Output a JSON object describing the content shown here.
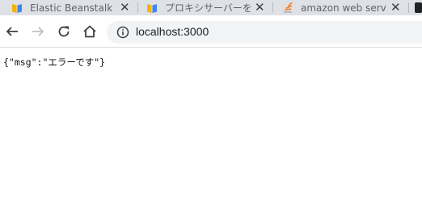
{
  "tabs": [
    {
      "title": "Elastic Beanstalk へのアク",
      "icon": "book-icon",
      "close": "✕"
    },
    {
      "title": "プロキシサーバーを設定す",
      "icon": "book-icon",
      "close": "✕"
    },
    {
      "title": "amazon web services",
      "icon": "stack-icon",
      "close": "✕"
    }
  ],
  "toolbar": {
    "back_icon": "arrow-left-icon",
    "forward_icon": "arrow-right-icon",
    "reload_icon": "reload-icon",
    "home_icon": "home-icon",
    "url": "localhost:3000",
    "info_icon": "info-icon"
  },
  "page": {
    "body_text": "{\"msg\":\"エラーです\"}"
  },
  "colors": {
    "tabstrip": "#dee1e6",
    "omnibox": "#f1f3f4",
    "icon": "#5f6368",
    "accent_orange": "#f48024"
  }
}
